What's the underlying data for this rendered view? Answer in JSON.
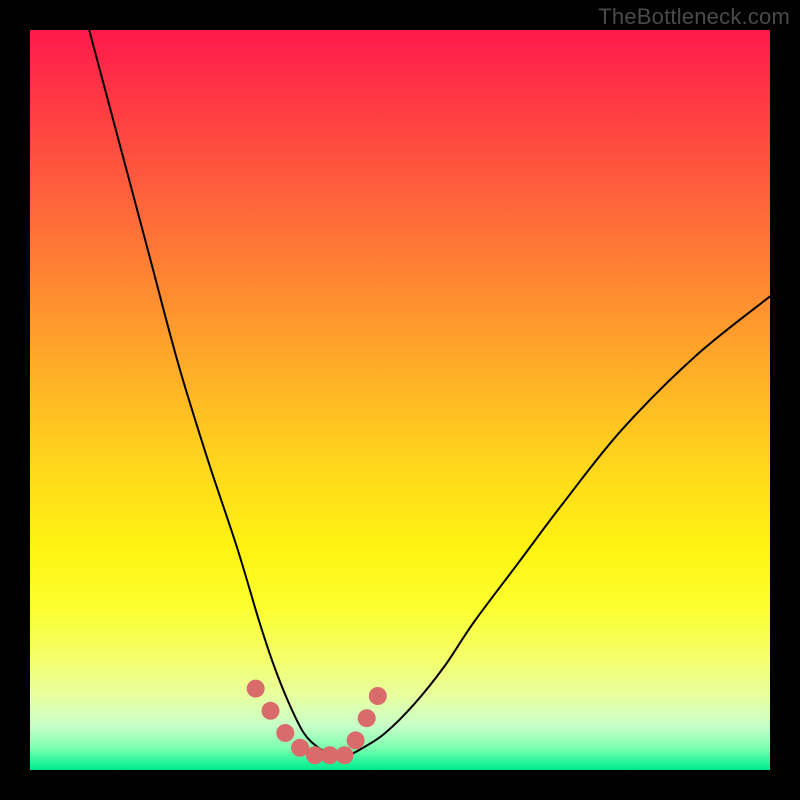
{
  "watermark": "TheBottleneck.com",
  "chart_data": {
    "type": "line",
    "title": "",
    "xlabel": "",
    "ylabel": "",
    "xlim": [
      0,
      100
    ],
    "ylim": [
      0,
      100
    ],
    "series": [
      {
        "name": "bottleneck-curve",
        "x": [
          8,
          12,
          16,
          20,
          24,
          28,
          31,
          33,
          35,
          37,
          39,
          41,
          43,
          45,
          48,
          52,
          56,
          60,
          66,
          72,
          80,
          90,
          100
        ],
        "y": [
          100,
          85,
          70,
          55,
          42,
          30,
          20,
          14,
          9,
          5,
          3,
          2,
          2,
          3,
          5,
          9,
          14,
          20,
          28,
          36,
          46,
          56,
          64
        ]
      }
    ],
    "markers": {
      "name": "highlight-dots",
      "color": "#d96b6b",
      "x": [
        30.5,
        32.5,
        34.5,
        36.5,
        38.5,
        40.5,
        42.5,
        44,
        45.5,
        47
      ],
      "y": [
        11,
        8,
        5,
        3,
        2,
        2,
        2,
        4,
        7,
        10
      ]
    },
    "gradient_stops": [
      {
        "pos": 0,
        "color": "#ff1a4b"
      },
      {
        "pos": 50,
        "color": "#ffda1b"
      },
      {
        "pos": 100,
        "color": "#00e88c"
      }
    ]
  }
}
